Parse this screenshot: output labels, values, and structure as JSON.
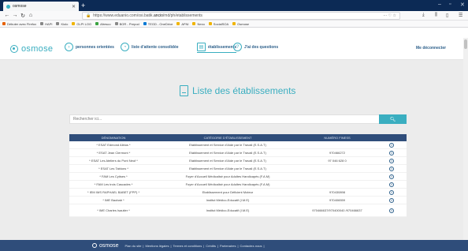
{
  "browser": {
    "tab_title": "osmose",
    "url_prefix": "https://www.eduanio.com/osi.batik.",
    "url_domain": "ancio",
    "url_suffix": "/md/ph/etablissements",
    "bookmarks": [
      {
        "label": "Débuter avec Firefox",
        "color": "#e66000"
      },
      {
        "label": "HAPI",
        "color": "#888888"
      },
      {
        "label": "Kiolo",
        "color": "#888888"
      },
      {
        "label": "GLPI LOG",
        "color": "#f0b400"
      },
      {
        "label": "Afresco",
        "color": "#3aa341"
      },
      {
        "label": "BOR - Prepod",
        "color": "#888888"
      },
      {
        "label": "TEGD - OneDrive",
        "color": "#0078d4"
      },
      {
        "label": "AFNI",
        "color": "#f0b400"
      },
      {
        "label": "Nexo",
        "color": "#f0b400"
      },
      {
        "label": "SocialSOA",
        "color": "#f0b400"
      },
      {
        "label": "Osmose",
        "color": "#f0b400"
      }
    ]
  },
  "site": {
    "logo_text": "osmose",
    "menu": [
      {
        "label": "personnes orientées",
        "icon": "arrow-circle-icon"
      },
      {
        "label": "liste d'attente consolidée",
        "icon": "clock-icon"
      },
      {
        "label": "établissements",
        "icon": "building-icon"
      },
      {
        "label": "J'ai des questions",
        "icon": "question-icon"
      }
    ],
    "logout": "Me déconnecter"
  },
  "page": {
    "title": "Liste des établissements",
    "search_placeholder": "Rechercher ici...",
    "search_button_icon": "search-icon"
  },
  "table": {
    "headers": [
      "DÉNOMINATION",
      "CATÉGORIE D'ÉTABLISSEMENT",
      "NUMÉRO FINESS",
      ""
    ],
    "rows": [
      {
        "name": "* ESAT Edmond Albius *",
        "category": "Etablissement et Service d'Aide par le Travail (E.S.A.T)",
        "finess": ""
      },
      {
        "name": "* ESAT Jean Clermont *",
        "category": "Etablissement et Service d'Aide par le Travail (E.S.A.T)",
        "finess": "970466272"
      },
      {
        "name": "* ESAT Les Ateliers du Pont Neuf *",
        "category": "Etablissement et Service d'Aide par le Travail (E.S.A.T)",
        "finess": "97 046 628 0"
      },
      {
        "name": "* ESAT Les Tablons *",
        "category": "Etablissement et Service d'Aide par le Travail (E.S.A.T)",
        "finess": ""
      },
      {
        "name": "* FAM Les Cytises *",
        "category": "Foyer d'Accueil Médicalisé pour Adultes Handicapés (F.A.M)",
        "finess": ""
      },
      {
        "name": "* FAM Les trois Cascades *",
        "category": "Foyer d'Accueil Médicalisé pour Adultes Handicapés (F.A.M)",
        "finess": ""
      },
      {
        "name": "* IEM IMS RAPHAEL BABET (FPP) *",
        "category": "Etablissement pour Déficient Moteur",
        "finess": "970430898"
      },
      {
        "name": "* IME Baobab *",
        "category": "Institut Médico-Educatif (I.M.E)",
        "finess": "970406559"
      },
      {
        "name": "* IME Charles Isautier *",
        "category": "Institut Médico-Educatif (I.M.E)",
        "finess": "970466637/970400040 /970466637"
      }
    ]
  },
  "footer": {
    "logo_text": "osmose",
    "links": [
      "Plan du site",
      "Mentions légales",
      "Termes et conditions",
      "Crédits",
      "Partenaires",
      "Contactez-nous"
    ]
  }
}
